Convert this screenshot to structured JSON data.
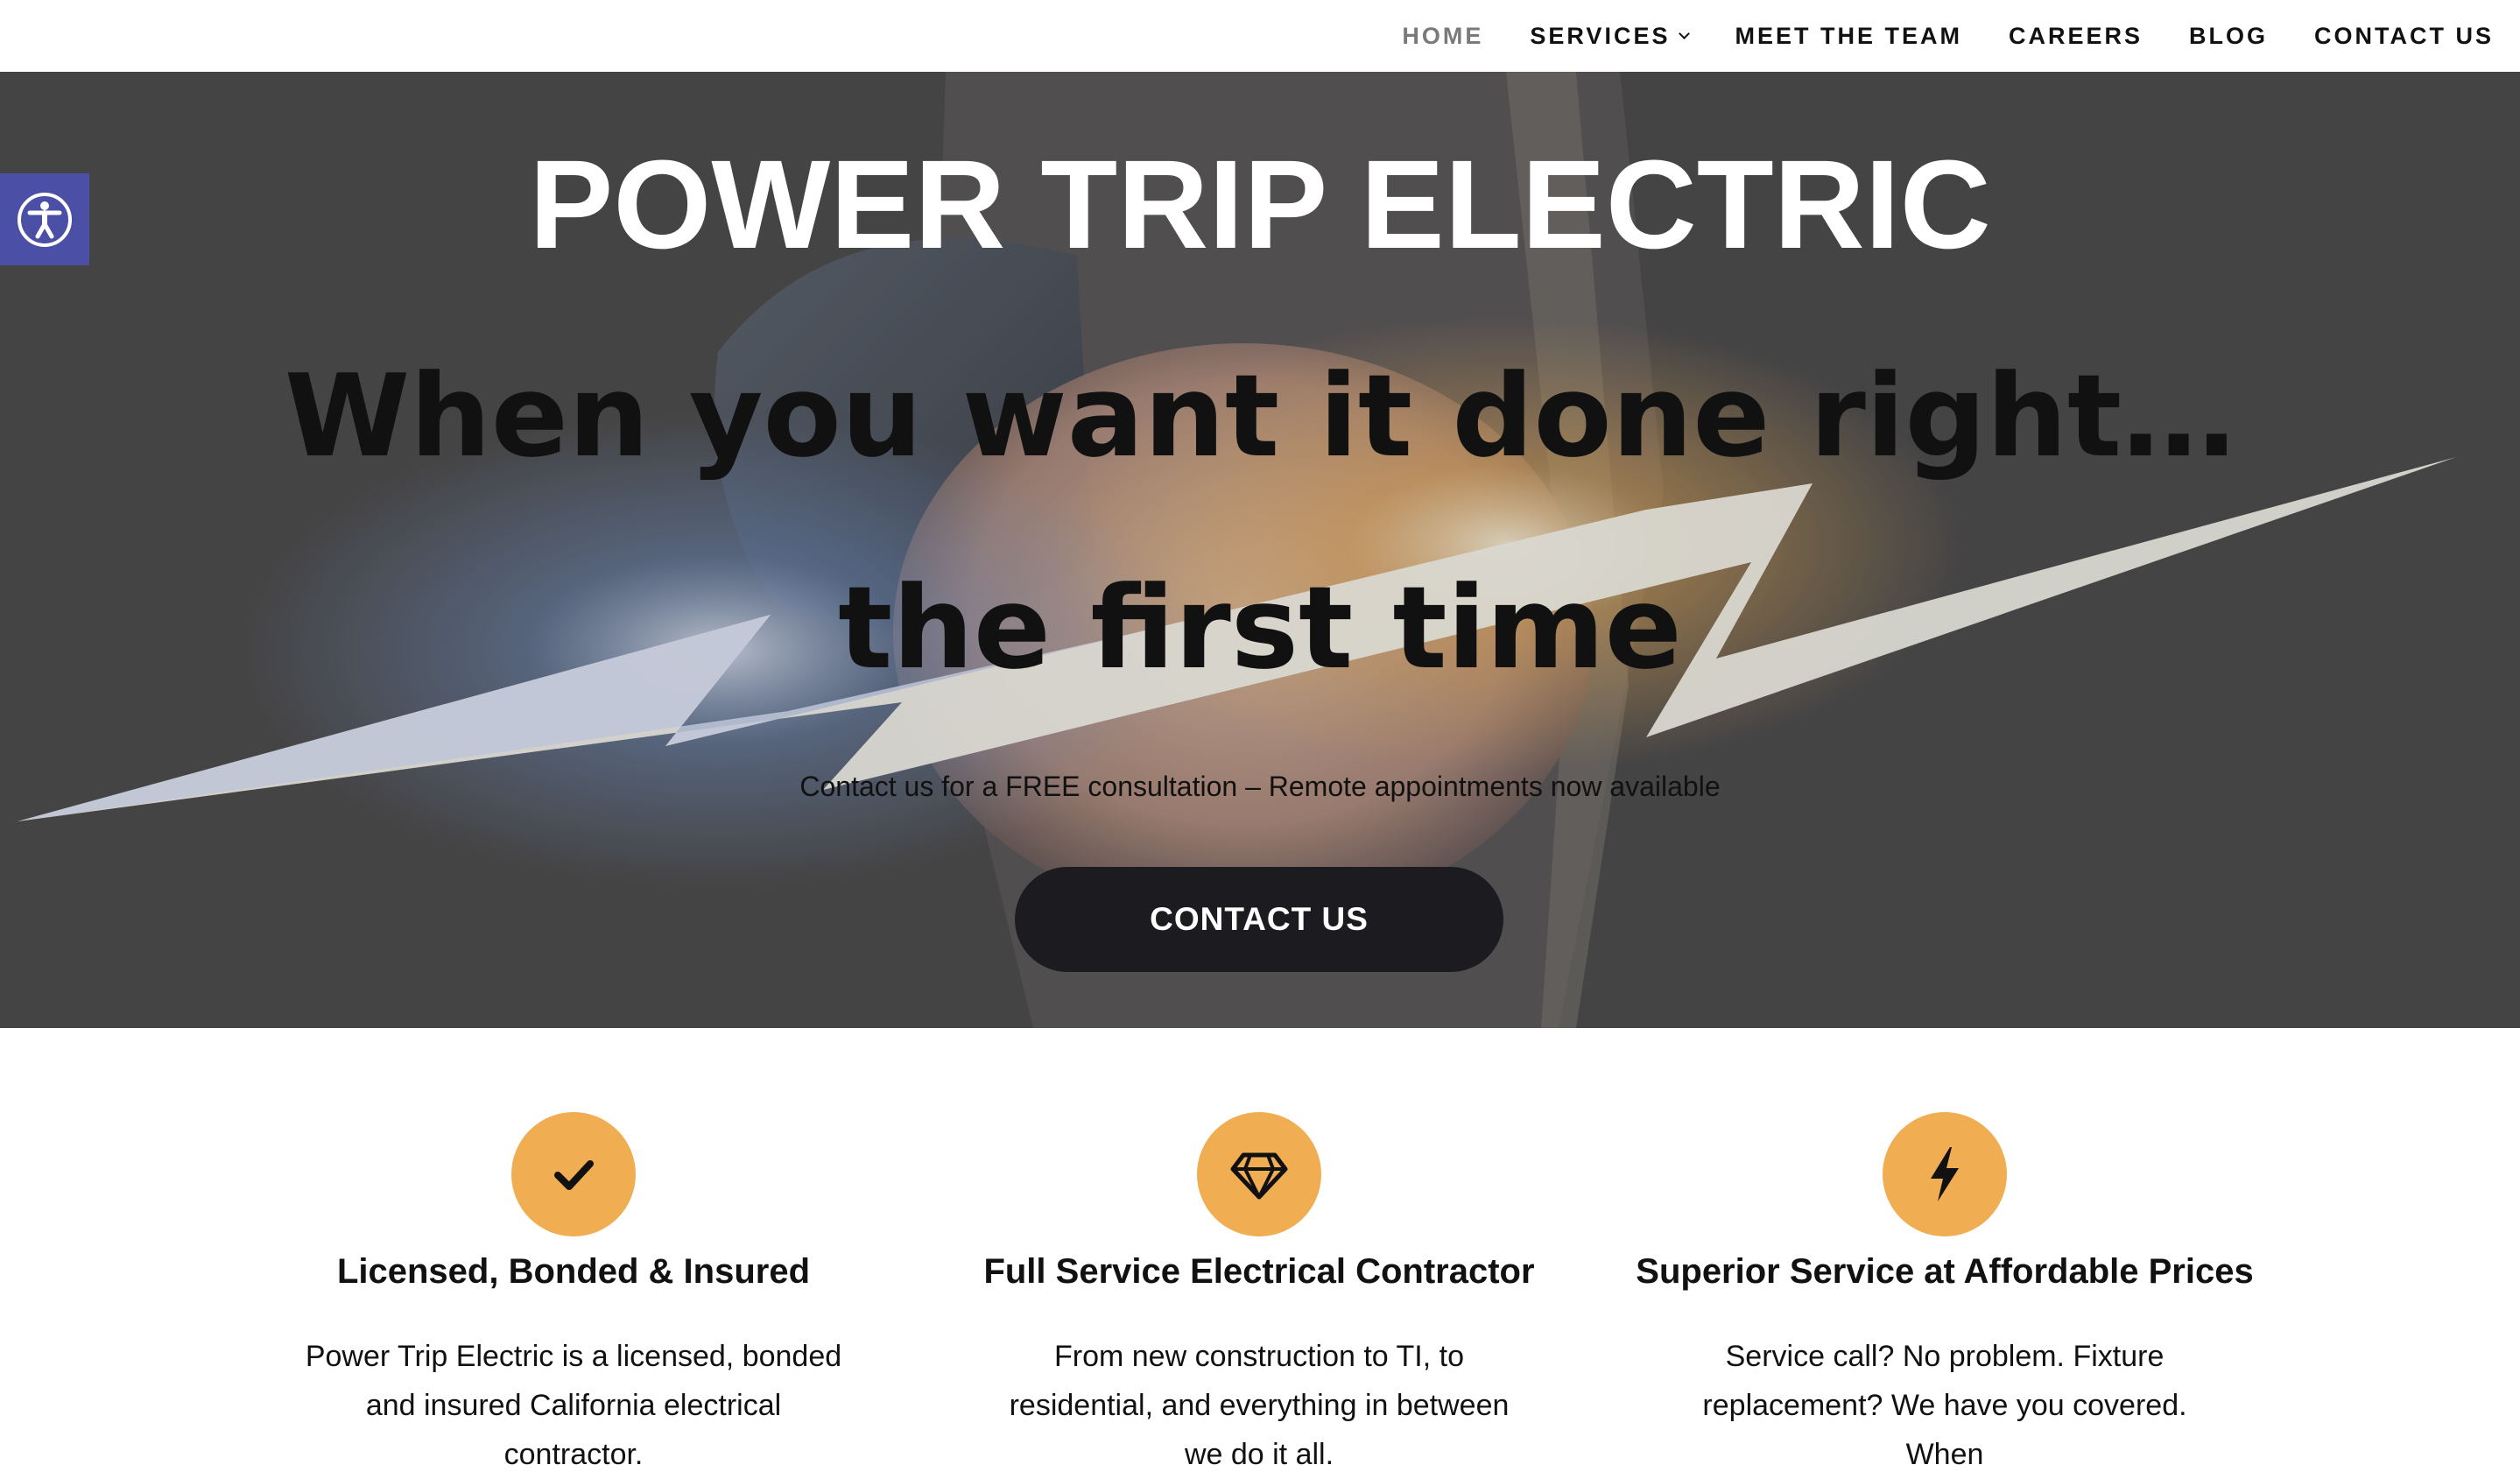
{
  "nav": {
    "items": [
      {
        "label": "HOME",
        "active": true
      },
      {
        "label": "SERVICES",
        "has_dropdown": true
      },
      {
        "label": "MEET THE TEAM"
      },
      {
        "label": "CAREERS"
      },
      {
        "label": "BLOG"
      },
      {
        "label": "CONTACT US"
      }
    ]
  },
  "accessibility": {
    "icon": "accessibility-icon",
    "color": "#4b4fa5"
  },
  "hero": {
    "title": "POWER TRIP ELECTRIC",
    "subtitle_line1": "When you want it done right…",
    "subtitle_line2": "the first time",
    "text": "Contact us for a FREE consultation – Remote appointments now available",
    "button_label": "CONTACT US",
    "button_color": "#1c1c20"
  },
  "features": [
    {
      "icon": "checkmark-icon",
      "title": "Licensed, Bonded & Insured",
      "text": "Power Trip Electric is a licensed, bonded and insured California electrical contractor."
    },
    {
      "icon": "diamond-icon",
      "title": "Full Service Electrical Contractor",
      "text": "From new construction to TI, to residential, and everything in between we do it all."
    },
    {
      "icon": "lightning-bolt-icon",
      "title": "Superior Service at Affordable Prices",
      "text": "Service call? No problem. Fixture replacement? We have you covered. When"
    }
  ],
  "colors": {
    "accent": "#f0ad52",
    "hero_overlay": "#4b4a4b",
    "text": "#111111"
  }
}
